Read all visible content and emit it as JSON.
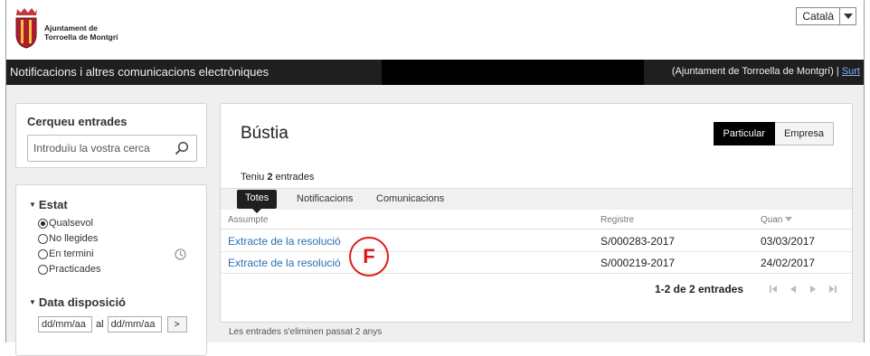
{
  "header": {
    "logo_line1": "Ajuntament de",
    "logo_line2": "Torroella de Montgrí",
    "language": "Català"
  },
  "navbar": {
    "title": "Notificacions i altres comunicacions electròniques",
    "user_text": "(Ajuntament de Torroella de Montgrí) |",
    "logout": "Surt"
  },
  "search": {
    "title": "Cerqueu entrades",
    "placeholder": "Introduïu la vostra cerca"
  },
  "filters": {
    "estat_title": "Estat",
    "options": [
      "Qualsevol",
      "No llegides",
      "En termini",
      "Practicades"
    ],
    "selected": "Qualsevol",
    "data_title": "Data disposició",
    "date_from": "dd/mm/aa",
    "date_to": "dd/mm/aa",
    "date_sep": "al",
    "go": ">"
  },
  "main": {
    "title": "Bústia",
    "segments": [
      "Particular",
      "Empresa"
    ],
    "count_prefix": "Teniu",
    "count": "2",
    "count_suffix": "entrades",
    "tabs": [
      "Totes",
      "Notificacions",
      "Comunicacions"
    ],
    "columns": [
      "Assumpte",
      "Registre",
      "Quan"
    ],
    "rows": [
      {
        "subject": "Extracte de la resolució",
        "registre": "S/000283-2017",
        "date": "03/03/2017"
      },
      {
        "subject": "Extracte de la resolució",
        "registre": "S/000219-2017",
        "date": "24/02/2017"
      }
    ],
    "pager": "1-2 de 2 entrades"
  },
  "footer_note": "Les entrades s'eliminen passat 2 anys",
  "annotation_letter": "F",
  "colors": {
    "link": "#2a6fb0",
    "navbar": "#1f1f1f",
    "annotation": "#e01818"
  }
}
